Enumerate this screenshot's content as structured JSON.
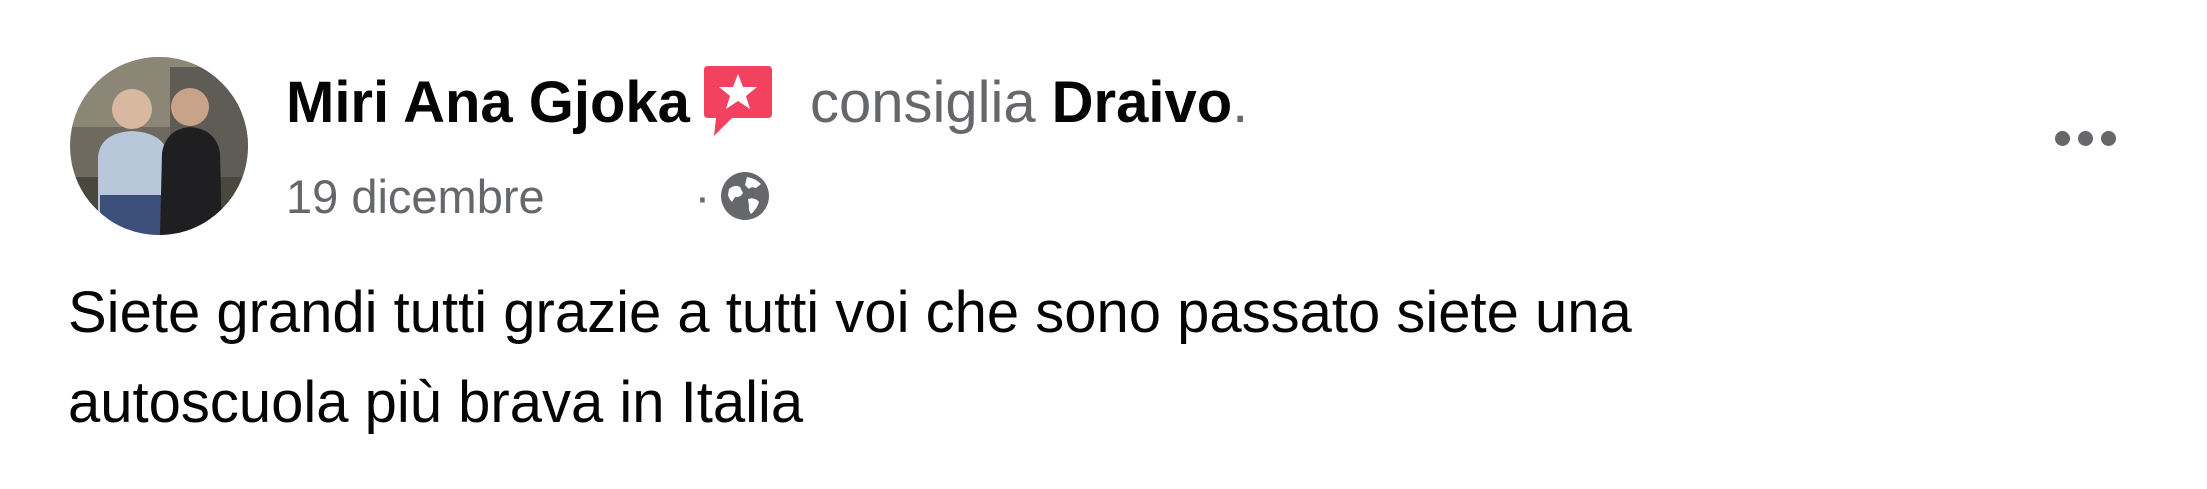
{
  "post": {
    "author_name": "Miri Ana Gjoka",
    "action_text": "consiglia",
    "page_name": "Draivo",
    "period": ".",
    "timestamp": "19 dicembre",
    "separator": "·",
    "body_line1": "Siete grandi tutti grazie a tutti voi che sono passato siete una",
    "body_line2": "autoscuola più brava in Italia"
  },
  "icons": {
    "avatar": "avatar-photo",
    "recommendation": "recommendation-star-icon",
    "privacy": "globe-icon",
    "more": "more-options-icon"
  },
  "colors": {
    "primary_text": "#050505",
    "secondary_text": "#65676b",
    "recommend_badge": "#f3425f"
  }
}
